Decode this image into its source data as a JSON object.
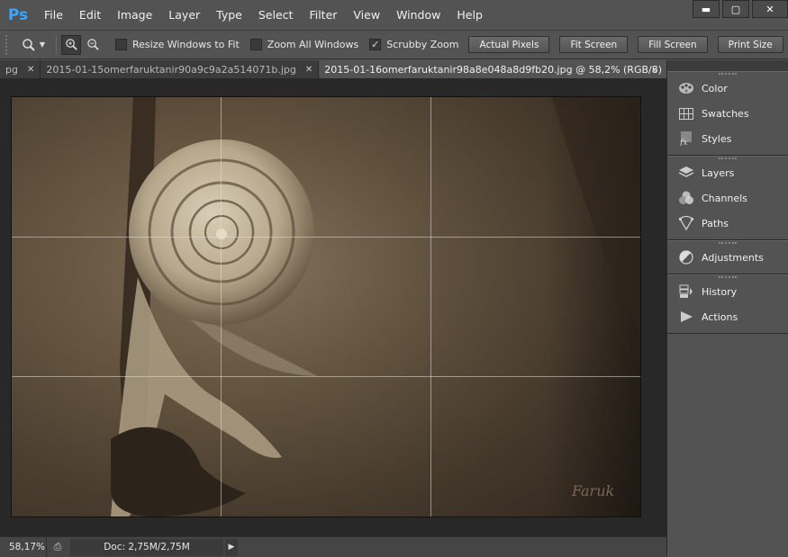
{
  "app": {
    "logo": "Ps"
  },
  "menu": [
    "File",
    "Edit",
    "Image",
    "Layer",
    "Type",
    "Select",
    "Filter",
    "View",
    "Window",
    "Help"
  ],
  "window_controls": {
    "minimize": "▬",
    "maximize": "▢",
    "close": "✕"
  },
  "options_bar": {
    "zoom_tool_icon": "zoom-icon",
    "checkboxes": [
      {
        "label": "Resize Windows to Fit",
        "checked": false
      },
      {
        "label": "Zoom All Windows",
        "checked": false
      },
      {
        "label": "Scrubby Zoom",
        "checked": true
      }
    ],
    "buttons": [
      "Actual Pixels",
      "Fit Screen",
      "Fill Screen",
      "Print Size"
    ]
  },
  "tabs": [
    {
      "label": "pg",
      "active": false
    },
    {
      "label": "2015-01-15omerfaruktanir90a9c9a2a514071b.jpg",
      "active": false
    },
    {
      "label": "2015-01-16omerfaruktanir98a8e048a8d9fb20.jpg @ 58,2% (RGB/8)",
      "active": true
    }
  ],
  "tab_overflow": "»",
  "image": {
    "signature": "Faruk"
  },
  "status": {
    "zoom": "58,17%",
    "doc": "Doc: 2,75M/2,75M"
  },
  "panels": [
    {
      "items": [
        {
          "label": "Color",
          "icon": "color-icon"
        },
        {
          "label": "Swatches",
          "icon": "swatches-icon"
        },
        {
          "label": "Styles",
          "icon": "styles-icon"
        }
      ]
    },
    {
      "items": [
        {
          "label": "Layers",
          "icon": "layers-icon"
        },
        {
          "label": "Channels",
          "icon": "channels-icon"
        },
        {
          "label": "Paths",
          "icon": "paths-icon"
        }
      ]
    },
    {
      "items": [
        {
          "label": "Adjustments",
          "icon": "adjustments-icon"
        }
      ]
    },
    {
      "items": [
        {
          "label": "History",
          "icon": "history-icon"
        },
        {
          "label": "Actions",
          "icon": "actions-icon"
        }
      ]
    }
  ],
  "colors": {
    "accent": "#37a6ff",
    "panel_bg": "#535353",
    "canvas_bg": "#282828"
  }
}
